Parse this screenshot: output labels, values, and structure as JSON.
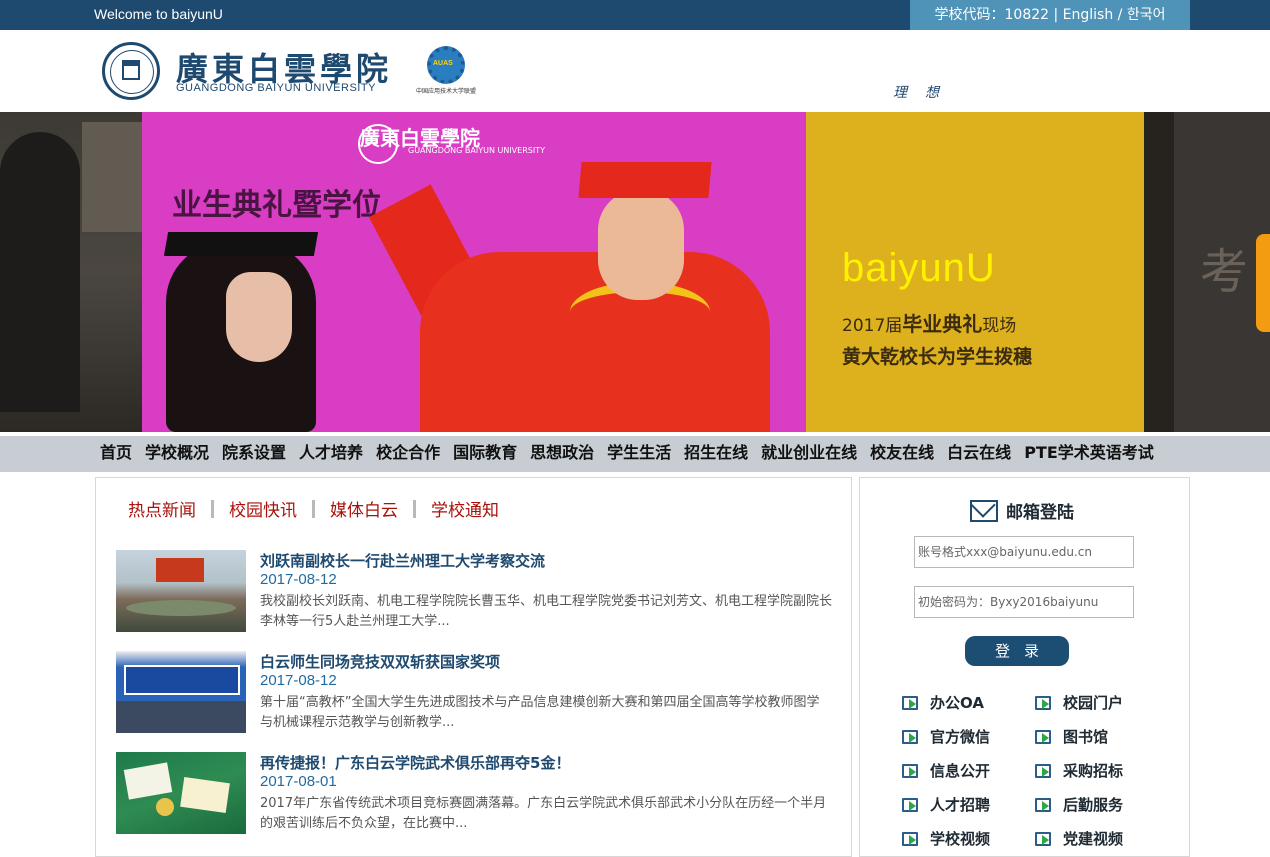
{
  "topbar": {
    "welcome": "Welcome to baiyunU",
    "code": "学校代码：10822",
    "divider1": " | ",
    "english": "English",
    "divider2": " / ",
    "korean": "한국어"
  },
  "header": {
    "school_cn": "廣東白雲學院",
    "school_en": "GUANGDONG BAIYUN UNIVERSITY",
    "auas_badge": "AUAS",
    "auas_text": "中国应用技术大学联盟",
    "motto": "理想"
  },
  "banner": {
    "logo_cn": "廣東白雲學院",
    "logo_en": "GUANGDONG BAIYUN UNIVERSITY",
    "ceremony_title": "业生典礼暨学位",
    "brand": "baiyunU",
    "line1_prefix": "2017届",
    "line1_bold": "毕业典礼",
    "line1_suffix": "现场",
    "line2": "黄大乾校长为学生拨穗"
  },
  "nav": {
    "items": [
      "首页",
      "学校概况",
      "院系设置",
      "人才培养",
      "校企合作",
      "国际教育",
      "思想政治",
      "学生生活",
      "招生在线",
      "就业创业在线",
      "校友在线",
      "白云在线",
      "PTE学术英语考试"
    ]
  },
  "news": {
    "tabs": [
      "热点新闻",
      "校园快讯",
      "媒体白云",
      "学校通知"
    ],
    "items": [
      {
        "title": "刘跃南副校长一行赴兰州理工大学考察交流",
        "date": "2017-08-12",
        "summary": "我校副校长刘跃南、机电工程学院院长曹玉华、机电工程学院党委书记刘芳文、机电工程学院副院长李林等一行5人赴兰州理工大学..."
      },
      {
        "title": "白云师生同场竞技双双斩获国家奖项",
        "date": "2017-08-12",
        "summary": "第十届“高教杯”全国大学生先进成图技术与产品信息建模创新大赛和第四届全国高等学校教师图学与机械课程示范教学与创新教学..."
      },
      {
        "title": "再传捷报！广东白云学院武术俱乐部再夺5金！",
        "date": "2017-08-01",
        "summary": "2017年广东省传统武术项目竞标赛圆满落幕。广东白云学院武术俱乐部武术小分队在历经一个半月的艰苦训练后不负众望，在比赛中..."
      }
    ]
  },
  "mail": {
    "title": "邮箱登陆",
    "account_placeholder": "账号格式xxx@baiyunu.edu.cn",
    "password_placeholder": "初始密码为：Byxy2016baiyunu",
    "login_label": "登录",
    "links": [
      "办公OA",
      "校园门户",
      "官方微信",
      "图书馆",
      "信息公开",
      "采购招标",
      "人才招聘",
      "后勤服务",
      "学校视频",
      "党建视频"
    ]
  }
}
